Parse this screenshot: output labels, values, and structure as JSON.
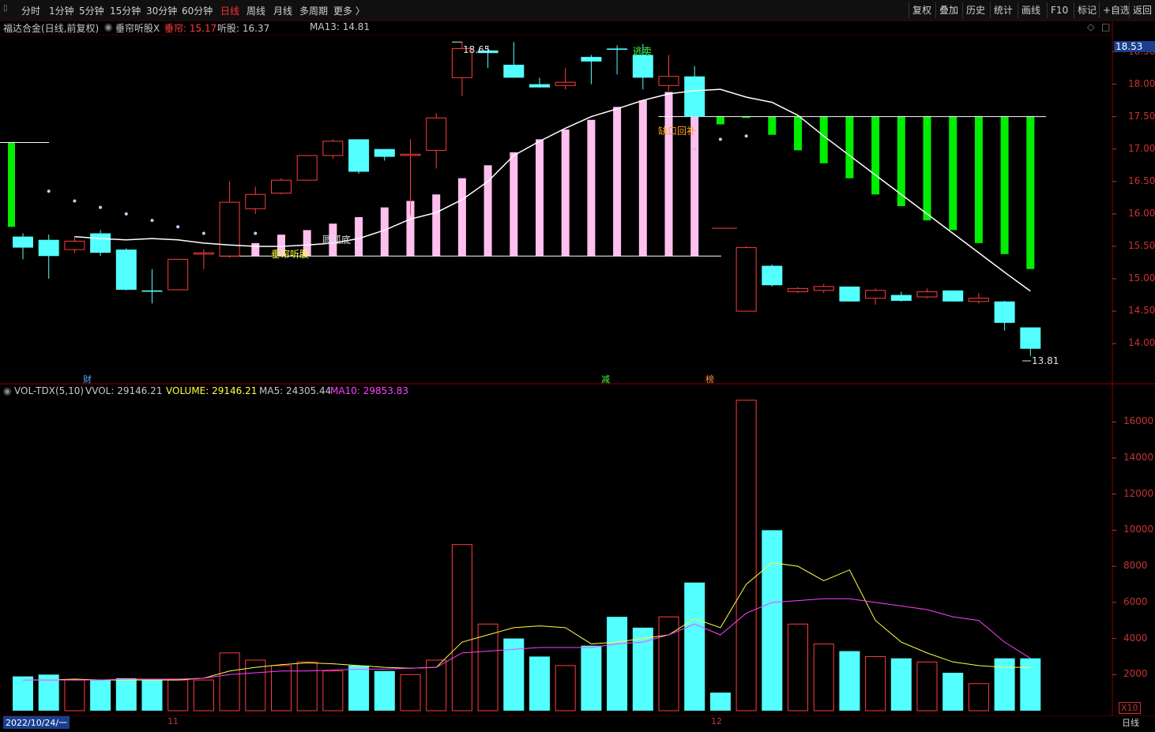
{
  "toolbar": {
    "periods": [
      {
        "label": "分时",
        "active": false
      },
      {
        "label": "1分钟",
        "active": false
      },
      {
        "label": "5分钟",
        "active": false
      },
      {
        "label": "15分钟",
        "active": false
      },
      {
        "label": "30分钟",
        "active": false
      },
      {
        "label": "60分钟",
        "active": false
      },
      {
        "label": "日线",
        "active": true
      },
      {
        "label": "周线",
        "active": false
      },
      {
        "label": "月线",
        "active": false
      },
      {
        "label": "多周期",
        "active": false
      },
      {
        "label": "更多 〉",
        "active": false
      }
    ],
    "right": [
      "复权",
      "叠加",
      "历史",
      "统计",
      "画线",
      "F10",
      "标记",
      "+自选",
      "返回"
    ]
  },
  "main_info": {
    "stock": "福达合金(日线,前复权)",
    "indicator": "垂帘听股X",
    "drop_label": "垂帘: 15.17",
    "listen_label": "听股: 16.37",
    "ma_label": "MA13: 14.81"
  },
  "vol_info": {
    "name": "VOL-TDX(5,10)",
    "vvol": "VVOL: 29146.21",
    "volume": "VOLUME: 29146.21",
    "ma5": "MA5: 24305.44",
    "ma10": "MA10: 29853.83"
  },
  "price_axis": {
    "current": "18.53",
    "labels": [
      "18.50",
      "18.00",
      "17.50",
      "17.00",
      "16.50",
      "16.00",
      "15.50",
      "15.00",
      "14.50",
      "14.00"
    ]
  },
  "vol_axis": {
    "labels": [
      "16000",
      "14000",
      "12000",
      "10000",
      "8000",
      "6000",
      "4000",
      "2000"
    ],
    "unit": "X10"
  },
  "bottom": {
    "date": "2022/10/24/一",
    "month_11": "11",
    "month_12": "12",
    "period": "日线"
  },
  "markers": {
    "cai": "财",
    "jian": "减",
    "bang": "榜"
  },
  "annotations": {
    "high": "18.65",
    "low": "13.81",
    "sell": "逃卖",
    "gap": "缺口回补",
    "round_bottom": "圆弧底",
    "curtain": "垂帘听股"
  },
  "colors": {
    "up": "#ff3c3c",
    "down": "#54ffff",
    "pink": "#ffc0ef",
    "green": "#00ee00",
    "ma": "#ffffff",
    "ma5": "#ffff40",
    "ma10": "#ff40ff"
  },
  "chart_data": {
    "type": "candlestick",
    "candles": [
      {
        "o": 15.65,
        "h": 15.7,
        "c": 15.48,
        "l": 15.3
      },
      {
        "o": 15.6,
        "h": 15.68,
        "c": 15.35,
        "l": 15.0
      },
      {
        "o": 15.45,
        "h": 15.65,
        "c": 15.58,
        "l": 15.4
      },
      {
        "o": 15.7,
        "h": 15.75,
        "c": 15.4,
        "l": 15.35
      },
      {
        "o": 15.45,
        "h": 15.47,
        "c": 14.83,
        "l": 14.82
      },
      {
        "o": 14.82,
        "h": 15.15,
        "c": 14.8,
        "l": 14.62
      },
      {
        "o": 14.83,
        "h": 15.3,
        "c": 15.3,
        "l": 14.82
      },
      {
        "o": 15.38,
        "h": 15.45,
        "c": 15.4,
        "l": 15.15
      },
      {
        "o": 15.35,
        "h": 16.5,
        "c": 16.18,
        "l": 15.32
      },
      {
        "o": 16.08,
        "h": 16.42,
        "c": 16.3,
        "l": 16.0
      },
      {
        "o": 16.32,
        "h": 16.55,
        "c": 16.52,
        "l": 16.3
      },
      {
        "o": 16.52,
        "h": 16.9,
        "c": 16.9,
        "l": 16.52
      },
      {
        "o": 16.9,
        "h": 17.15,
        "c": 17.12,
        "l": 16.85
      },
      {
        "o": 17.15,
        "h": 17.15,
        "c": 16.65,
        "l": 16.62
      },
      {
        "o": 17.0,
        "h": 17.0,
        "c": 16.88,
        "l": 16.82
      },
      {
        "o": 16.9,
        "h": 17.15,
        "c": 16.92,
        "l": 15.98
      },
      {
        "o": 16.98,
        "h": 17.55,
        "c": 17.48,
        "l": 16.7
      },
      {
        "o": 18.1,
        "h": 18.65,
        "c": 18.55,
        "l": 17.82
      },
      {
        "o": 18.52,
        "h": 18.58,
        "c": 18.48,
        "l": 18.25
      },
      {
        "o": 18.3,
        "h": 18.65,
        "c": 18.1,
        "l": 18.1
      },
      {
        "o": 18.0,
        "h": 18.1,
        "c": 17.95,
        "l": 17.95
      },
      {
        "o": 17.98,
        "h": 18.25,
        "c": 18.03,
        "l": 17.92
      },
      {
        "o": 18.42,
        "h": 18.45,
        "c": 18.35,
        "l": 18.0
      },
      {
        "o": 18.55,
        "h": 18.6,
        "c": 18.53,
        "l": 18.15
      },
      {
        "o": 18.45,
        "h": 18.62,
        "c": 18.1,
        "l": 17.92
      },
      {
        "o": 17.98,
        "h": 18.45,
        "c": 18.12,
        "l": 17.9
      },
      {
        "o": 18.12,
        "h": 18.28,
        "c": 17.5,
        "l": 17.48
      },
      {
        "o": null
      },
      {
        "o": 14.5,
        "h": 15.5,
        "c": 15.48,
        "l": 14.5
      },
      {
        "o": 15.2,
        "h": 15.22,
        "c": 14.9,
        "l": 14.88
      },
      {
        "o": 14.8,
        "h": 14.87,
        "c": 14.85,
        "l": 14.78
      },
      {
        "o": 14.82,
        "h": 14.92,
        "c": 14.88,
        "l": 14.78
      },
      {
        "o": 14.88,
        "h": 14.88,
        "c": 14.65,
        "l": 14.65
      },
      {
        "o": 14.7,
        "h": 14.85,
        "c": 14.82,
        "l": 14.6
      },
      {
        "o": 14.75,
        "h": 14.8,
        "c": 14.66,
        "l": 14.65
      },
      {
        "o": 14.72,
        "h": 14.85,
        "c": 14.8,
        "l": 14.7
      },
      {
        "o": 14.82,
        "h": 14.82,
        "c": 14.65,
        "l": 14.65
      },
      {
        "o": 14.65,
        "h": 14.78,
        "c": 14.7,
        "l": 14.62
      },
      {
        "o": 14.65,
        "h": 14.66,
        "c": 14.32,
        "l": 14.2
      },
      {
        "o": 14.25,
        "h": 14.25,
        "c": 13.92,
        "l": 13.81
      }
    ],
    "ma13": [
      15.65,
      15.62,
      15.6,
      15.62,
      15.6,
      15.55,
      15.52,
      15.5,
      15.5,
      15.52,
      15.55,
      15.62,
      15.75,
      15.92,
      16.02,
      16.22,
      16.5,
      16.9,
      17.12,
      17.32,
      17.5,
      17.62,
      17.75,
      17.85,
      17.9,
      17.92,
      17.8,
      17.72,
      17.52,
      17.2,
      16.9,
      16.6,
      16.3,
      16.0,
      15.7,
      15.4,
      15.1,
      14.81
    ],
    "pink_bars": [
      [
        9,
        15.55
      ],
      [
        10,
        15.68
      ],
      [
        11,
        15.75
      ],
      [
        12,
        15.85
      ],
      [
        13,
        15.95
      ],
      [
        14,
        16.1
      ],
      [
        15,
        16.2
      ],
      [
        16,
        16.3
      ],
      [
        17,
        16.55
      ],
      [
        18,
        16.75
      ],
      [
        19,
        16.95
      ],
      [
        20,
        17.15
      ],
      [
        21,
        17.3
      ],
      [
        22,
        17.45
      ],
      [
        23,
        17.65
      ],
      [
        24,
        17.75
      ],
      [
        25,
        17.88
      ],
      [
        26,
        17.92
      ]
    ],
    "green_bars": [
      [
        27,
        17.38
      ],
      [
        28,
        17.48
      ],
      [
        29,
        17.22
      ],
      [
        30,
        16.98
      ],
      [
        31,
        16.78
      ],
      [
        32,
        16.55
      ],
      [
        33,
        16.3
      ],
      [
        34,
        16.12
      ],
      [
        35,
        15.9
      ],
      [
        36,
        15.75
      ],
      [
        37,
        15.55
      ],
      [
        38,
        15.38
      ],
      [
        39,
        15.15
      ]
    ],
    "dots": [
      [
        1,
        16.35
      ],
      [
        2,
        16.2
      ],
      [
        3,
        16.1
      ],
      [
        4,
        16.0
      ],
      [
        5,
        15.9
      ],
      [
        6,
        15.8
      ],
      [
        7,
        15.7
      ],
      [
        9,
        15.7
      ],
      [
        26,
        17.0
      ],
      [
        27,
        17.15
      ],
      [
        28,
        17.2
      ]
    ],
    "volume": [
      {
        "v": 1900,
        "up": false
      },
      {
        "v": 2000,
        "up": false
      },
      {
        "v": 1700,
        "up": true
      },
      {
        "v": 1700,
        "up": false
      },
      {
        "v": 1800,
        "up": false
      },
      {
        "v": 1700,
        "up": false
      },
      {
        "v": 1700,
        "up": true
      },
      {
        "v": 1700,
        "up": true
      },
      {
        "v": 3200,
        "up": true
      },
      {
        "v": 2800,
        "up": true
      },
      {
        "v": 2500,
        "up": true
      },
      {
        "v": 2700,
        "up": true
      },
      {
        "v": 2200,
        "up": true
      },
      {
        "v": 2500,
        "up": false
      },
      {
        "v": 2200,
        "up": false
      },
      {
        "v": 2000,
        "up": true
      },
      {
        "v": 2800,
        "up": true
      },
      {
        "v": 9200,
        "up": true
      },
      {
        "v": 4800,
        "up": true
      },
      {
        "v": 4000,
        "up": false
      },
      {
        "v": 3000,
        "up": false
      },
      {
        "v": 2500,
        "up": true
      },
      {
        "v": 3600,
        "up": false
      },
      {
        "v": 5200,
        "up": false
      },
      {
        "v": 4600,
        "up": false
      },
      {
        "v": 5200,
        "up": true
      },
      {
        "v": 7100,
        "up": false
      },
      {
        "v": 1000,
        "up": false
      },
      {
        "v": 17200,
        "up": true
      },
      {
        "v": 10000,
        "up": false
      },
      {
        "v": 4800,
        "up": true
      },
      {
        "v": 3700,
        "up": true
      },
      {
        "v": 3300,
        "up": false
      },
      {
        "v": 3000,
        "up": true
      },
      {
        "v": 2900,
        "up": false
      },
      {
        "v": 2700,
        "up": true
      },
      {
        "v": 2100,
        "up": false
      },
      {
        "v": 1500,
        "up": true
      },
      {
        "v": 2900,
        "up": false
      },
      {
        "v": 2900,
        "up": false
      }
    ],
    "vol_ma5": [
      1700,
      1700,
      1750,
      1700,
      1700,
      1700,
      1700,
      1800,
      2200,
      2400,
      2550,
      2650,
      2600,
      2500,
      2400,
      2350,
      2400,
      3800,
      4200,
      4600,
      4700,
      4600,
      3700,
      3800,
      4000,
      4200,
      5100,
      4600,
      7000,
      8200,
      8000,
      7200,
      7800,
      5000,
      3800,
      3200,
      2700,
      2500,
      2400,
      2400
    ],
    "vol_ma10": [
      1700,
      1700,
      1700,
      1700,
      1750,
      1750,
      1750,
      1800,
      2000,
      2100,
      2200,
      2200,
      2250,
      2300,
      2300,
      2350,
      2400,
      3200,
      3300,
      3400,
      3500,
      3500,
      3500,
      3700,
      3800,
      4200,
      4800,
      4200,
      5400,
      6000,
      6100,
      6200,
      6200,
      6000,
      5800,
      5600,
      5200,
      5000,
      3800,
      2900
    ],
    "price_range": [
      13.6,
      18.75
    ],
    "vol_range": [
      0,
      17500
    ]
  }
}
